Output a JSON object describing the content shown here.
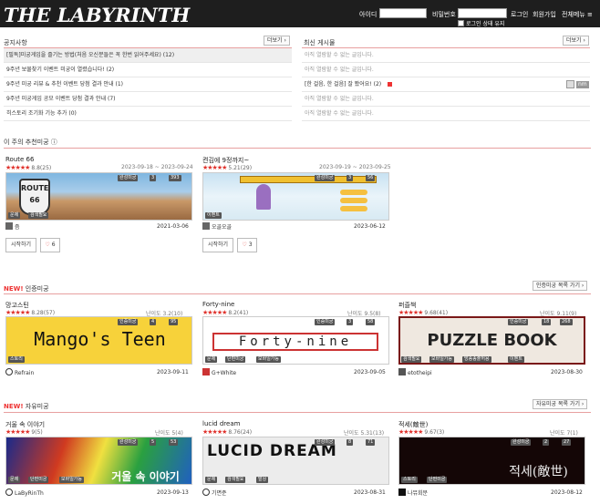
{
  "header": {
    "logo": "THE LABYRINTH",
    "id_label": "아이디",
    "pw_label": "비밀번호",
    "login": "로그인",
    "signup": "회원가입",
    "menu": "전체메뉴 ≡",
    "keep_login": "로그인 상태 유지"
  },
  "notice": {
    "title": "공지사항",
    "more": "더보기 ›",
    "items": [
      "[필독]미궁게임을 즐기는 방법(처음 오신분들은 꼭 한번 읽어주세요) (12)",
      "9주년 보물찾기 이벤트 미궁이 열렸습니다! (2)",
      "9주년 미궁 리뷰 & 추천 이벤트 당첨 결과 안내 (1)",
      "9주년 미궁게임 공모 이벤트 당첨 결과 안내 (7)",
      "히스토리 조기화 기능 추가 (0)"
    ]
  },
  "latest": {
    "title": "최신 게시물",
    "more": "더보기 ›",
    "items": [
      "아직 열람할 수 없는 글입니다.",
      "아직 열람할 수 없는 글입니다.",
      "[한 걸음, 한 걸음] 잘 봤어요! (2)",
      "아직 열람할 수 없는 글입니다.",
      "아직 열람할 수 없는 글입니다."
    ],
    "badge": "nm"
  },
  "recommend": {
    "title": "이 주의 추천미궁 ⓘ",
    "cards": [
      {
        "title": "Route 66",
        "stars": "★★★★★",
        "score": "8.8(25)",
        "period": "2023-09-18 ~ 2023-09-24",
        "counts": [
          "완성미궁",
          "3",
          "393"
        ],
        "tags": [
          "운제",
          "검색필요"
        ],
        "author": "즘",
        "date": "2021-03-06",
        "start": "시작하기",
        "likes": "6",
        "thumb_text": "ROUTE 66"
      },
      {
        "title": "켠김에 9정까지~",
        "stars": "★★★★★",
        "score": "5.21(29)",
        "period": "2023-09-19 ~ 2023-09-25",
        "counts": [
          "완성미궁",
          "3",
          "56"
        ],
        "tags": [
          "이벤트"
        ],
        "author": "오골오골",
        "date": "2023-06-12",
        "start": "시작하기",
        "likes": "3",
        "thumb_text": ""
      }
    ]
  },
  "certified": {
    "new": "NEW!",
    "title": " 인증미궁",
    "more": "인증미궁 목록 가기 ›",
    "cards": [
      {
        "title": "망고스틴",
        "stars": "★★★★★",
        "score": "8.28(57)",
        "diff": "난이도 3.2(10)",
        "counts": [
          "인증미궁",
          "4",
          "95"
        ],
        "tags": [
          "스토리"
        ],
        "author": "Refrain",
        "date": "2023-09-11",
        "thumb_text": "Mango's Teen"
      },
      {
        "title": "Forty-nine",
        "stars": "★★★★★",
        "score": "8.2(41)",
        "diff": "난이도 9.5(8)",
        "counts": [
          "인증미궁",
          "3",
          "58"
        ],
        "tags": [
          "문제",
          "단편미궁",
          "모바일가능"
        ],
        "author": "G+White",
        "date": "2023-09-05",
        "thumb_text": "Forty-nine"
      },
      {
        "title": "퍼즐책",
        "stars": "★★★★★",
        "score": "9.68(41)",
        "diff": "난이도 9.11(9)",
        "counts": [
          "인증미궁",
          "18",
          "268"
        ],
        "tags": [
          "검색필요",
          "모바일가능",
          "방송송출허용",
          "이벤트"
        ],
        "author": "etotheipi",
        "date": "2023-08-30",
        "thumb_text": "PUZZLE BOOK"
      }
    ]
  },
  "free": {
    "new": "NEW!",
    "title": " 자유미궁",
    "more": "자유미궁 목록 가기 ›",
    "cards": [
      {
        "title": "거울 속 이야기",
        "stars": "★★★★★",
        "score": "9(5)",
        "diff": "난이도 5(4)",
        "counts": [
          "완성미궁",
          "5",
          "53"
        ],
        "tags": [
          "문제",
          "단편미궁",
          "모바일가능"
        ],
        "author": "LaByRinTh",
        "date": "2023-09-13",
        "thumb_text": "거울 속 이야기"
      },
      {
        "title": "lucid dream",
        "stars": "★★★★★",
        "score": "8.76(24)",
        "diff": "난이도 5.31(13)",
        "counts": [
          "완성미궁",
          "8",
          "71"
        ],
        "tags": [
          "문제",
          "검색필요",
          "발상"
        ],
        "author": "기면준",
        "date": "2023-08-31",
        "thumb_text": "LUCID DREAM"
      },
      {
        "title": "적세(敵世)",
        "stars": "★★★★★",
        "score": "9.67(3)",
        "diff": "난이도 7(1)",
        "counts": [
          "완성미궁",
          "2",
          "27"
        ],
        "tags": [
          "스토리",
          "단편미궁"
        ],
        "author": "나뮤회분",
        "date": "2023-08-12",
        "thumb_text": "적세(敵世)"
      }
    ]
  }
}
